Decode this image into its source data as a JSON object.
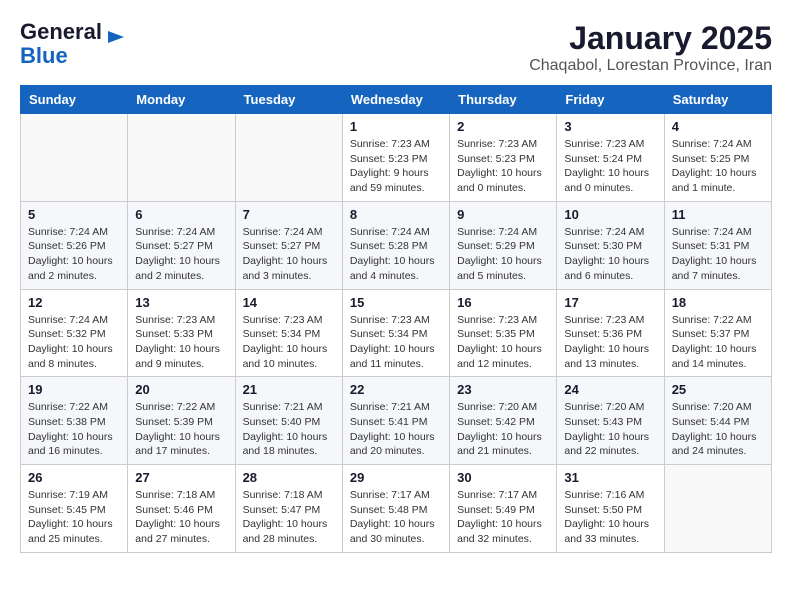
{
  "logo": {
    "line1": "General",
    "line2": "Blue"
  },
  "header": {
    "month_year": "January 2025",
    "location": "Chaqabol, Lorestan Province, Iran"
  },
  "weekdays": [
    "Sunday",
    "Monday",
    "Tuesday",
    "Wednesday",
    "Thursday",
    "Friday",
    "Saturday"
  ],
  "weeks": [
    [
      {
        "day": "",
        "info": ""
      },
      {
        "day": "",
        "info": ""
      },
      {
        "day": "",
        "info": ""
      },
      {
        "day": "1",
        "info": "Sunrise: 7:23 AM\nSunset: 5:23 PM\nDaylight: 9 hours and 59 minutes."
      },
      {
        "day": "2",
        "info": "Sunrise: 7:23 AM\nSunset: 5:23 PM\nDaylight: 10 hours and 0 minutes."
      },
      {
        "day": "3",
        "info": "Sunrise: 7:23 AM\nSunset: 5:24 PM\nDaylight: 10 hours and 0 minutes."
      },
      {
        "day": "4",
        "info": "Sunrise: 7:24 AM\nSunset: 5:25 PM\nDaylight: 10 hours and 1 minute."
      }
    ],
    [
      {
        "day": "5",
        "info": "Sunrise: 7:24 AM\nSunset: 5:26 PM\nDaylight: 10 hours and 2 minutes."
      },
      {
        "day": "6",
        "info": "Sunrise: 7:24 AM\nSunset: 5:27 PM\nDaylight: 10 hours and 2 minutes."
      },
      {
        "day": "7",
        "info": "Sunrise: 7:24 AM\nSunset: 5:27 PM\nDaylight: 10 hours and 3 minutes."
      },
      {
        "day": "8",
        "info": "Sunrise: 7:24 AM\nSunset: 5:28 PM\nDaylight: 10 hours and 4 minutes."
      },
      {
        "day": "9",
        "info": "Sunrise: 7:24 AM\nSunset: 5:29 PM\nDaylight: 10 hours and 5 minutes."
      },
      {
        "day": "10",
        "info": "Sunrise: 7:24 AM\nSunset: 5:30 PM\nDaylight: 10 hours and 6 minutes."
      },
      {
        "day": "11",
        "info": "Sunrise: 7:24 AM\nSunset: 5:31 PM\nDaylight: 10 hours and 7 minutes."
      }
    ],
    [
      {
        "day": "12",
        "info": "Sunrise: 7:24 AM\nSunset: 5:32 PM\nDaylight: 10 hours and 8 minutes."
      },
      {
        "day": "13",
        "info": "Sunrise: 7:23 AM\nSunset: 5:33 PM\nDaylight: 10 hours and 9 minutes."
      },
      {
        "day": "14",
        "info": "Sunrise: 7:23 AM\nSunset: 5:34 PM\nDaylight: 10 hours and 10 minutes."
      },
      {
        "day": "15",
        "info": "Sunrise: 7:23 AM\nSunset: 5:34 PM\nDaylight: 10 hours and 11 minutes."
      },
      {
        "day": "16",
        "info": "Sunrise: 7:23 AM\nSunset: 5:35 PM\nDaylight: 10 hours and 12 minutes."
      },
      {
        "day": "17",
        "info": "Sunrise: 7:23 AM\nSunset: 5:36 PM\nDaylight: 10 hours and 13 minutes."
      },
      {
        "day": "18",
        "info": "Sunrise: 7:22 AM\nSunset: 5:37 PM\nDaylight: 10 hours and 14 minutes."
      }
    ],
    [
      {
        "day": "19",
        "info": "Sunrise: 7:22 AM\nSunset: 5:38 PM\nDaylight: 10 hours and 16 minutes."
      },
      {
        "day": "20",
        "info": "Sunrise: 7:22 AM\nSunset: 5:39 PM\nDaylight: 10 hours and 17 minutes."
      },
      {
        "day": "21",
        "info": "Sunrise: 7:21 AM\nSunset: 5:40 PM\nDaylight: 10 hours and 18 minutes."
      },
      {
        "day": "22",
        "info": "Sunrise: 7:21 AM\nSunset: 5:41 PM\nDaylight: 10 hours and 20 minutes."
      },
      {
        "day": "23",
        "info": "Sunrise: 7:20 AM\nSunset: 5:42 PM\nDaylight: 10 hours and 21 minutes."
      },
      {
        "day": "24",
        "info": "Sunrise: 7:20 AM\nSunset: 5:43 PM\nDaylight: 10 hours and 22 minutes."
      },
      {
        "day": "25",
        "info": "Sunrise: 7:20 AM\nSunset: 5:44 PM\nDaylight: 10 hours and 24 minutes."
      }
    ],
    [
      {
        "day": "26",
        "info": "Sunrise: 7:19 AM\nSunset: 5:45 PM\nDaylight: 10 hours and 25 minutes."
      },
      {
        "day": "27",
        "info": "Sunrise: 7:18 AM\nSunset: 5:46 PM\nDaylight: 10 hours and 27 minutes."
      },
      {
        "day": "28",
        "info": "Sunrise: 7:18 AM\nSunset: 5:47 PM\nDaylight: 10 hours and 28 minutes."
      },
      {
        "day": "29",
        "info": "Sunrise: 7:17 AM\nSunset: 5:48 PM\nDaylight: 10 hours and 30 minutes."
      },
      {
        "day": "30",
        "info": "Sunrise: 7:17 AM\nSunset: 5:49 PM\nDaylight: 10 hours and 32 minutes."
      },
      {
        "day": "31",
        "info": "Sunrise: 7:16 AM\nSunset: 5:50 PM\nDaylight: 10 hours and 33 minutes."
      },
      {
        "day": "",
        "info": ""
      }
    ]
  ]
}
